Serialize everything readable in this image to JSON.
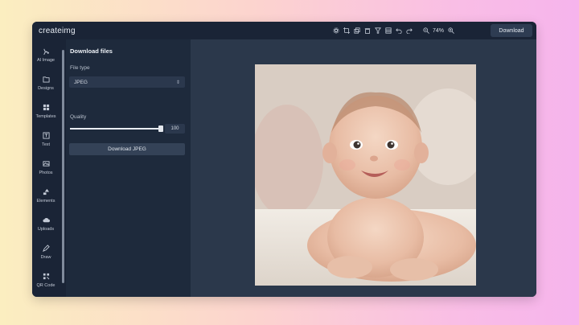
{
  "app": {
    "logo": "createimg"
  },
  "toolbar": {
    "icons": [
      "gear-icon",
      "crop-icon",
      "duplicate-icon",
      "trash-icon",
      "filter-icon",
      "layers-icon",
      "undo-icon",
      "redo-icon"
    ],
    "zoom_out_icon": "zoom-out-icon",
    "zoom_level": "74%",
    "zoom_in_icon": "zoom-in-icon",
    "download_label": "Download"
  },
  "sidebar": {
    "items": [
      {
        "label": "AI Image",
        "icon": "sparkle-icon"
      },
      {
        "label": "Designs",
        "icon": "folder-icon"
      },
      {
        "label": "Templates",
        "icon": "grid-icon"
      },
      {
        "label": "Text",
        "icon": "text-icon"
      },
      {
        "label": "Photos",
        "icon": "image-icon"
      },
      {
        "label": "Elements",
        "icon": "shapes-icon"
      },
      {
        "label": "Uploads",
        "icon": "cloud-upload-icon"
      },
      {
        "label": "Draw",
        "icon": "pencil-icon"
      },
      {
        "label": "QR Code",
        "icon": "qr-code-icon"
      }
    ]
  },
  "panel": {
    "title": "Download files",
    "file_type_label": "File type",
    "file_type_value": "JPEG",
    "quality_label": "Quality",
    "quality_value": "100",
    "quality_fraction": 1.0,
    "download_button": "Download JPEG"
  },
  "canvas": {
    "icons": [
      "copy-icon",
      "add-page-icon"
    ]
  },
  "colors": {
    "window_bg": "#233043",
    "topbar_bg": "#1a2436",
    "panel_bg": "#1e2a3c",
    "canvas_bg": "#2b384b"
  }
}
